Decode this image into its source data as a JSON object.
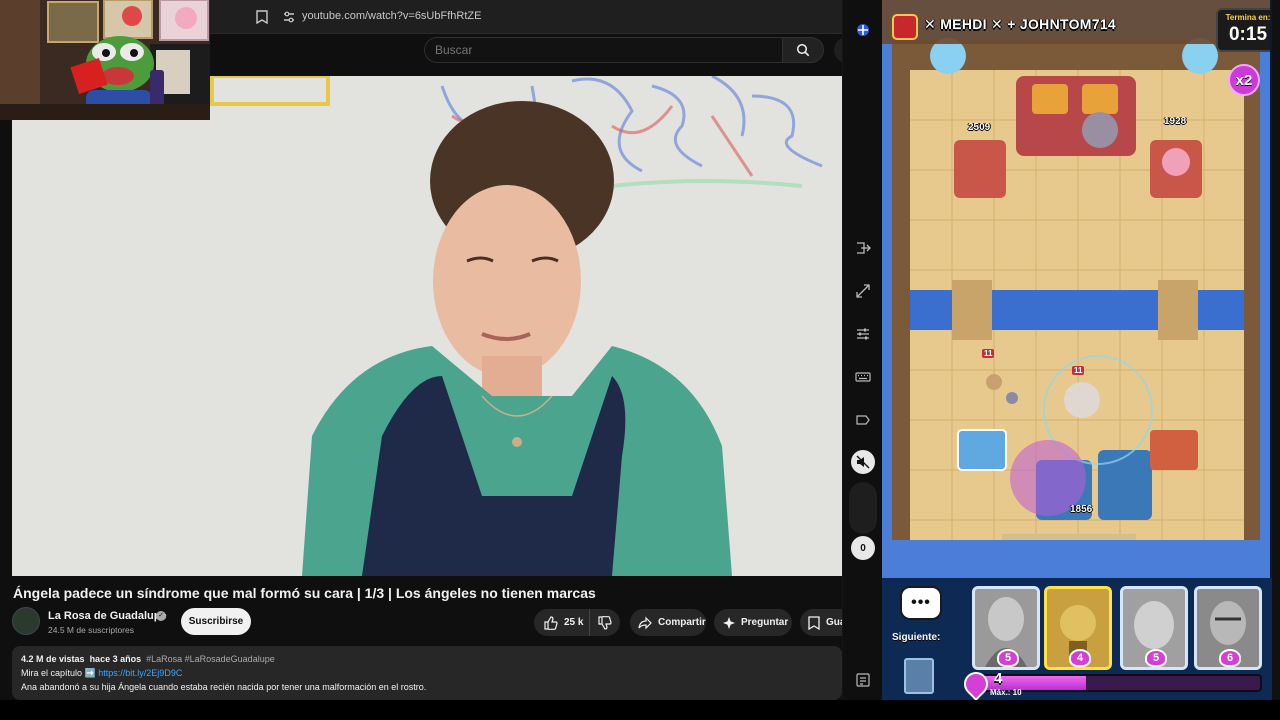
{
  "browser": {
    "url": "youtube.com/watch?v=6sUbFfhRtZE"
  },
  "youtube": {
    "search_placeholder": "Buscar",
    "video_title": "Ángela padece un síndrome que mal formó su cara | 1/3 | Los ángeles no tienen marcas",
    "channel_name": "La Rosa de Guadalupe",
    "subscribers": "24.5 M de suscriptores",
    "subscribe_label": "Suscribirse",
    "likes": "25 k",
    "share_label": "Compartir",
    "ask_label": "Preguntar",
    "save_label": "Gua",
    "views": "4.2 M de vistas",
    "age": "hace 3 años",
    "hashtags": "#LaRosa #LaRosadeGuadalupe",
    "chapter_text": "Mira el capítulo",
    "chapter_arrow": "➡️",
    "chapter_link": "https://bit.ly/2Ej9D9C",
    "description_line": "Ana abandonó a su hija Ángela cuando estaba recién nacida por tener una malformación en el rostro."
  },
  "side_panel": {
    "volume_value": "0"
  },
  "game": {
    "players": "✕ MEHDI ✕ + JOHNTOM714",
    "timer_label": "Termina en:",
    "timer_value": "0:15",
    "elixir_multiplier": "x2",
    "enemy_left_tower_hp": "2509",
    "enemy_right_tower_hp": "1928",
    "friendly_tower_hp": "1856",
    "troop_level_1": "11",
    "troop_level_2": "11",
    "next_label": "Siguiente:",
    "chat_label": "•••",
    "cards": [
      {
        "name": "archer-queen-card",
        "cost": "5"
      },
      {
        "name": "goblin-machine-card",
        "cost": "4"
      },
      {
        "name": "giant-card",
        "cost": "5"
      },
      {
        "name": "pekka-card",
        "cost": "6"
      }
    ],
    "elixir_current": "4",
    "elixir_max": "Máx.: 10",
    "elixir_fraction": 0.4,
    "colors": {
      "elixir": "#d63fd6",
      "river": "#3a6fd0",
      "sand": "#e7c98d"
    }
  }
}
